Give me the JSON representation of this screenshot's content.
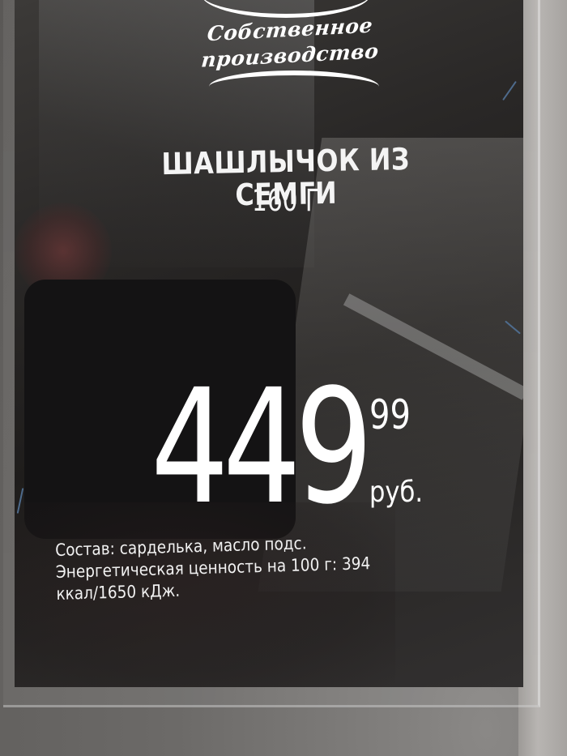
{
  "logo": {
    "line1": "Собственное",
    "line2": "производство"
  },
  "product": {
    "name": "ШАШЛЫЧОК ИЗ СЕМГИ",
    "weight": "160 Г"
  },
  "price": {
    "rubles": "449",
    "kopecks": "99",
    "currency": "руб."
  },
  "composition": {
    "line1": "Состав: сарделька, масло подс.",
    "line2": "Энергетическая ценность на 100 г: 394",
    "line3": "ккал/1650 кДж."
  },
  "colors": {
    "card": "#1f1d1c",
    "text": "#ffffff",
    "surface": "#a6a3a0"
  }
}
